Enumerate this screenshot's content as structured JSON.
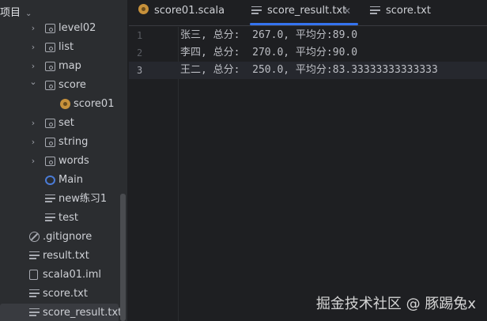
{
  "sidebar": {
    "title": "项目",
    "items": [
      {
        "label": "level02",
        "type": "folder",
        "expanded": false
      },
      {
        "label": "list",
        "type": "folder",
        "expanded": false
      },
      {
        "label": "map",
        "type": "folder",
        "expanded": false
      },
      {
        "label": "score",
        "type": "folder",
        "expanded": true
      },
      {
        "label": "score01",
        "type": "scala"
      },
      {
        "label": "set",
        "type": "folder",
        "expanded": false
      },
      {
        "label": "string",
        "type": "folder",
        "expanded": false
      },
      {
        "label": "words",
        "type": "folder",
        "expanded": false
      },
      {
        "label": "Main",
        "type": "main"
      },
      {
        "label": "new练习1",
        "type": "text"
      },
      {
        "label": "test",
        "type": "text"
      },
      {
        "label": ".gitignore",
        "type": "ignore"
      },
      {
        "label": "result.txt",
        "type": "text"
      },
      {
        "label": "scala01.iml",
        "type": "iml"
      },
      {
        "label": "score.txt",
        "type": "text"
      },
      {
        "label": "score_result.txt",
        "type": "text",
        "selected": true
      }
    ]
  },
  "tabs": [
    {
      "label": "score01.scala",
      "icon": "scala-icon"
    },
    {
      "label": "score_result.txt",
      "icon": "text-file-icon",
      "active": true
    },
    {
      "label": "score.txt",
      "icon": "text-file-icon"
    }
  ],
  "editor": {
    "lines": [
      {
        "n": "1",
        "text": "张三, 总分:  267.0, 平均分:89.0"
      },
      {
        "n": "2",
        "text": "李四, 总分:  270.0, 平均分:90.0"
      },
      {
        "n": "3",
        "text": "王二, 总分:  250.0, 平均分:83.33333333333333"
      }
    ]
  },
  "watermark": "掘金技术社区 @ 豚踢兔x",
  "colors": {
    "accent": "#3574f0",
    "sidebar": "#2b2d30",
    "editor": "#1e1f22"
  }
}
